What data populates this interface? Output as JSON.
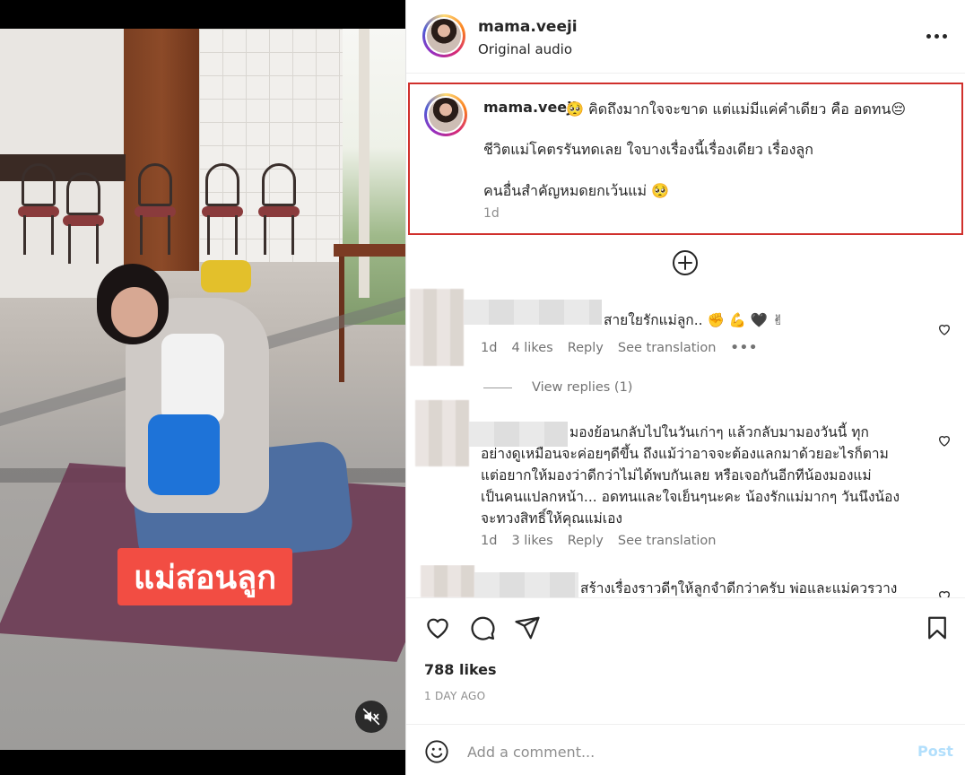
{
  "video": {
    "caption_overlay": "แม่สอนลูก",
    "mute_icon": "speaker-muted-icon"
  },
  "header": {
    "username": "mama.veeji",
    "audio": "Original audio",
    "more_icon": "more-horizontal-icon"
  },
  "caption": {
    "username": "mama.veeji",
    "line1": "🥺 คิดถึงมากใจจะขาด แต่แม่มีแค่คำเดียว คือ อดทน😔",
    "line2": "ชีวิตแม่โคตรรันทดเลย ใจบางเรื่องนี้เรื่องเดียว เรื่องลูก",
    "line3": "คนอื่นสำคัญหมดยกเว้นแม่ 🥺",
    "time": "1d",
    "highlight_color": "#d0302c"
  },
  "load_more_icon": "plus-circle-icon",
  "comments": [
    {
      "text": "สายใยรักแม่ลูก.. ✊ 💪 🖤 ✌",
      "time": "1d",
      "likes": "4 likes",
      "reply": "Reply",
      "translate": "See translation",
      "more": "•••"
    },
    {
      "lines": [
        "มองย้อนกลับไปในวันเก่าๆ แล้วกลับมามองวันนี้ ทุก",
        "อย่างดูเหมือนจะค่อยๆดีขึ้น ถึงแม้ว่าอาจจะต้องแลกมาด้วยอะไรก็ตาม",
        "แต่อยากให้มองว่าดีกว่าไม่ได้พบกันเลย หรือเจอกันอีกทีน้องมองแม่",
        "เป็นคนแปลกหน้า... อดทนและใจเย็นๆนะคะ น้องรักแม่มากๆ วันนึงน้อง",
        "จะทวงสิทธิ์ให้คุณแม่เอง"
      ],
      "time": "1d",
      "likes": "3 likes",
      "reply": "Reply",
      "translate": "See translation"
    },
    {
      "text": "สร้างเรื่องราวดีๆให้ลูกจำดีกว่าครับ พ่อและแม่ควรวาง"
    }
  ],
  "view_replies": "View replies (1)",
  "actions": {
    "like_icon": "heart-icon",
    "comment_icon": "comment-icon",
    "share_icon": "send-icon",
    "save_icon": "bookmark-icon"
  },
  "likes": "788 likes",
  "post_date": "1 DAY AGO",
  "add_comment": {
    "placeholder": "Add a comment...",
    "post_label": "Post",
    "emoji_icon": "emoji-smile-icon",
    "post_color": "#b2dffc"
  }
}
